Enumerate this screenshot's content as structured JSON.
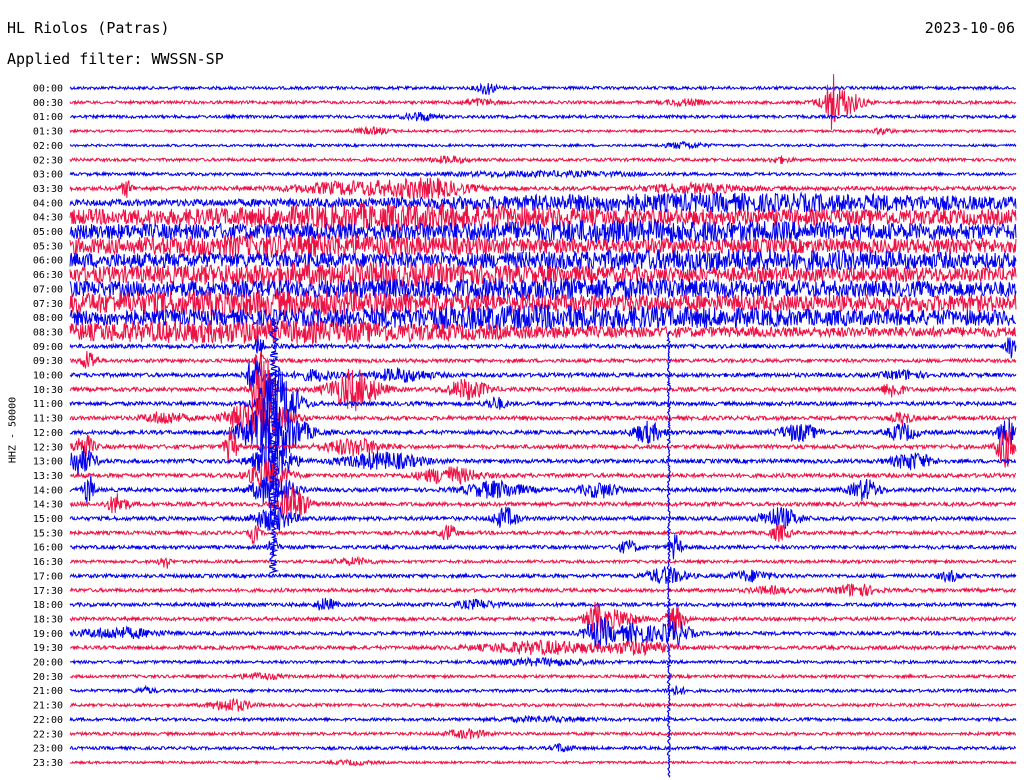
{
  "header": {
    "station": "HL Riolos (Patras)",
    "date": "2023-10-06",
    "filter": "Applied filter: WWSSN-SP"
  },
  "chart_data": {
    "type": "helicorder",
    "ylabel": "HHZ - 50000",
    "colors": [
      "#0000ee",
      "#ee1144"
    ],
    "row_minutes": 30,
    "rows": [
      {
        "label": "00:00",
        "base": 1.5,
        "events": [
          [
            0.44,
            6,
            0.01
          ]
        ]
      },
      {
        "label": "00:30",
        "base": 1.5,
        "events": [
          [
            0.43,
            3,
            0.02
          ],
          [
            0.65,
            3,
            0.02
          ],
          [
            0.805,
            28,
            0.004
          ],
          [
            0.815,
            14,
            0.02
          ]
        ]
      },
      {
        "label": "01:00",
        "base": 1.5,
        "events": [
          [
            0.37,
            4,
            0.015
          ]
        ]
      },
      {
        "label": "01:30",
        "base": 1.2,
        "events": [
          [
            0.32,
            3,
            0.02
          ],
          [
            0.86,
            3,
            0.01
          ]
        ]
      },
      {
        "label": "02:00",
        "base": 1.2,
        "events": [
          [
            0.65,
            3,
            0.02
          ]
        ]
      },
      {
        "label": "02:30",
        "base": 1.5,
        "events": [
          [
            0.4,
            3,
            0.02
          ],
          [
            0.75,
            3,
            0.01
          ]
        ]
      },
      {
        "label": "03:00",
        "base": 1.5,
        "events": [
          [
            0.5,
            2,
            0.1
          ]
        ]
      },
      {
        "label": "03:30",
        "base": 2.0,
        "events": [
          [
            0.06,
            8,
            0.006
          ],
          [
            0.3,
            6,
            0.06
          ],
          [
            0.38,
            8,
            0.04
          ],
          [
            0.66,
            4,
            0.05
          ]
        ]
      },
      {
        "label": "04:00",
        "base": 3.0,
        "events": [
          [
            0.7,
            7,
            0.35
          ]
        ]
      },
      {
        "label": "04:30",
        "base": 8.0,
        "events": [
          [
            0.35,
            6,
            0.15
          ]
        ]
      },
      {
        "label": "05:00",
        "base": 8.0,
        "events": [
          [
            0.6,
            4,
            0.2
          ]
        ]
      },
      {
        "label": "05:30",
        "base": 7.5,
        "events": [
          [
            0.25,
            5,
            0.15
          ]
        ]
      },
      {
        "label": "06:00",
        "base": 7.5,
        "events": [
          [
            0.7,
            4,
            0.2
          ]
        ]
      },
      {
        "label": "06:30",
        "base": 7.5,
        "events": [
          [
            0.3,
            5,
            0.2
          ]
        ]
      },
      {
        "label": "07:00",
        "base": 8.0,
        "events": [
          [
            0.5,
            4,
            0.2
          ]
        ]
      },
      {
        "label": "07:30",
        "base": 8.5,
        "events": [
          [
            0.2,
            5,
            0.2
          ]
        ]
      },
      {
        "label": "08:00",
        "base": 8.0,
        "events": [
          [
            0.5,
            5,
            0.2
          ]
        ]
      },
      {
        "label": "08:30",
        "base": 5.0,
        "events": [
          [
            0.2,
            7,
            0.25
          ]
        ]
      },
      {
        "label": "09:00",
        "base": 2.0,
        "events": [
          [
            0.2,
            14,
            0.004
          ],
          [
            0.995,
            12,
            0.005
          ]
        ]
      },
      {
        "label": "09:30",
        "base": 1.8,
        "events": [
          [
            0.02,
            10,
            0.008
          ],
          [
            0.2,
            10,
            0.004
          ]
        ]
      },
      {
        "label": "10:00",
        "base": 2.0,
        "events": [
          [
            0.195,
            20,
            0.008
          ],
          [
            0.26,
            5,
            0.02
          ],
          [
            0.35,
            6,
            0.03
          ],
          [
            0.88,
            4,
            0.02
          ]
        ]
      },
      {
        "label": "10:30",
        "base": 2.0,
        "events": [
          [
            0.205,
            35,
            0.01
          ],
          [
            0.3,
            20,
            0.025
          ],
          [
            0.42,
            10,
            0.02
          ],
          [
            0.87,
            8,
            0.01
          ]
        ]
      },
      {
        "label": "11:00",
        "base": 2.0,
        "events": [
          [
            0.22,
            35,
            0.02
          ],
          [
            0.45,
            6,
            0.01
          ]
        ]
      },
      {
        "label": "11:30",
        "base": 2.0,
        "events": [
          [
            0.1,
            6,
            0.02
          ],
          [
            0.2,
            20,
            0.03
          ],
          [
            0.88,
            6,
            0.01
          ]
        ]
      },
      {
        "label": "12:00",
        "base": 2.0,
        "events": [
          [
            0.215,
            30,
            0.03
          ],
          [
            0.61,
            10,
            0.015
          ],
          [
            0.77,
            8,
            0.02
          ],
          [
            0.88,
            8,
            0.015
          ],
          [
            0.99,
            14,
            0.01
          ]
        ]
      },
      {
        "label": "12:30",
        "base": 2.0,
        "events": [
          [
            0.015,
            12,
            0.01
          ],
          [
            0.17,
            20,
            0.006
          ],
          [
            0.3,
            8,
            0.03
          ],
          [
            0.99,
            20,
            0.01
          ]
        ]
      },
      {
        "label": "13:00",
        "base": 2.0,
        "events": [
          [
            0.01,
            14,
            0.015
          ],
          [
            0.215,
            20,
            0.02
          ],
          [
            0.33,
            8,
            0.04
          ],
          [
            0.89,
            8,
            0.02
          ]
        ]
      },
      {
        "label": "13:30",
        "base": 2.0,
        "events": [
          [
            0.21,
            14,
            0.02
          ],
          [
            0.4,
            8,
            0.03
          ]
        ]
      },
      {
        "label": "14:00",
        "base": 2.0,
        "events": [
          [
            0.02,
            16,
            0.005
          ],
          [
            0.215,
            18,
            0.02
          ],
          [
            0.45,
            8,
            0.03
          ],
          [
            0.56,
            7,
            0.02
          ],
          [
            0.84,
            10,
            0.015
          ]
        ]
      },
      {
        "label": "14:30",
        "base": 2.0,
        "events": [
          [
            0.05,
            10,
            0.01
          ],
          [
            0.235,
            18,
            0.015
          ]
        ]
      },
      {
        "label": "15:00",
        "base": 2.0,
        "events": [
          [
            0.215,
            12,
            0.02
          ],
          [
            0.46,
            10,
            0.012
          ],
          [
            0.75,
            10,
            0.02
          ]
        ]
      },
      {
        "label": "15:30",
        "base": 1.8,
        "events": [
          [
            0.195,
            10,
            0.005
          ],
          [
            0.4,
            8,
            0.008
          ],
          [
            0.75,
            8,
            0.01
          ]
        ]
      },
      {
        "label": "16:00",
        "base": 1.8,
        "events": [
          [
            0.215,
            10,
            0.005
          ],
          [
            0.59,
            6,
            0.01
          ],
          [
            0.64,
            12,
            0.006
          ]
        ]
      },
      {
        "label": "16:30",
        "base": 1.5,
        "events": [
          [
            0.1,
            8,
            0.005
          ],
          [
            0.3,
            3,
            0.02
          ]
        ]
      },
      {
        "label": "17:00",
        "base": 1.8,
        "events": [
          [
            0.63,
            8,
            0.02
          ],
          [
            0.72,
            5,
            0.02
          ],
          [
            0.93,
            5,
            0.01
          ]
        ]
      },
      {
        "label": "17:30",
        "base": 1.8,
        "events": [
          [
            0.74,
            3,
            0.02
          ],
          [
            0.83,
            6,
            0.02
          ]
        ]
      },
      {
        "label": "18:00",
        "base": 1.8,
        "events": [
          [
            0.27,
            6,
            0.01
          ],
          [
            0.43,
            4,
            0.02
          ]
        ]
      },
      {
        "label": "18:30",
        "base": 1.8,
        "events": [
          [
            0.555,
            14,
            0.01
          ],
          [
            0.58,
            8,
            0.02
          ],
          [
            0.64,
            12,
            0.01
          ]
        ]
      },
      {
        "label": "19:00",
        "base": 1.8,
        "events": [
          [
            0.05,
            5,
            0.04
          ],
          [
            0.56,
            14,
            0.015
          ],
          [
            0.6,
            10,
            0.02
          ],
          [
            0.64,
            12,
            0.015
          ]
        ]
      },
      {
        "label": "19:30",
        "base": 1.8,
        "events": [
          [
            0.5,
            6,
            0.06
          ],
          [
            0.6,
            6,
            0.03
          ]
        ]
      },
      {
        "label": "20:00",
        "base": 1.5,
        "events": [
          [
            0.5,
            3,
            0.05
          ]
        ]
      },
      {
        "label": "20:30",
        "base": 1.5,
        "events": [
          [
            0.2,
            3,
            0.02
          ]
        ]
      },
      {
        "label": "21:00",
        "base": 1.5,
        "events": [
          [
            0.08,
            3,
            0.01
          ],
          [
            0.64,
            4,
            0.01
          ]
        ]
      },
      {
        "label": "21:30",
        "base": 1.5,
        "events": [
          [
            0.17,
            6,
            0.02
          ]
        ]
      },
      {
        "label": "22:00",
        "base": 1.5,
        "events": [
          [
            0.5,
            2,
            0.05
          ]
        ]
      },
      {
        "label": "22:30",
        "base": 1.5,
        "events": [
          [
            0.42,
            4,
            0.02
          ]
        ]
      },
      {
        "label": "23:00",
        "base": 1.5,
        "events": [
          [
            0.52,
            4,
            0.01
          ]
        ]
      },
      {
        "label": "23:30",
        "base": 1.2,
        "events": [
          [
            0.3,
            2,
            0.02
          ]
        ]
      }
    ],
    "spikes": [
      {
        "x": 0.2155,
        "row_from": 16,
        "row_to": 33,
        "amp": 12
      },
      {
        "x": 0.633,
        "row_from": 17,
        "row_to": 48,
        "amp": 4
      }
    ]
  }
}
